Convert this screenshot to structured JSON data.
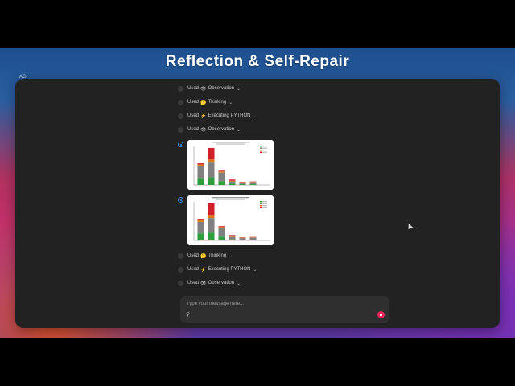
{
  "overlay": {
    "title": "Reflection & Self-Repair"
  },
  "sidebar_peek": {
    "label": "AGI"
  },
  "messages": [
    {
      "prefix": "Used",
      "icon": "👁",
      "icon_name": "eye-icon",
      "label": "Observation"
    },
    {
      "prefix": "Used",
      "icon": "🤔",
      "icon_name": "thinking-icon",
      "label": "Thinking"
    },
    {
      "prefix": "Used",
      "icon": "⚡",
      "icon_name": "lightning-icon",
      "label": "Executing PYTHON"
    },
    {
      "prefix": "Used",
      "icon": "👁",
      "icon_name": "eye-icon",
      "label": "Observation"
    },
    {
      "prefix": "Used",
      "icon": "🤔",
      "icon_name": "thinking-icon",
      "label": "Thinking"
    },
    {
      "prefix": "Used",
      "icon": "⚡",
      "icon_name": "lightning-icon",
      "label": "Executing PYTHON"
    },
    {
      "prefix": "Used",
      "icon": "👁",
      "icon_name": "eye-icon",
      "label": "Observation"
    }
  ],
  "chart_data": [
    {
      "type": "bar",
      "stacked": true,
      "categories": [
        "1",
        "2",
        "3",
        "4",
        "5",
        "6"
      ],
      "ylim": [
        0,
        100
      ],
      "series": [
        {
          "values": [
            18,
            20,
            10,
            3,
            2,
            2
          ],
          "color": "#2e9e3e"
        },
        {
          "values": [
            30,
            38,
            22,
            6,
            4,
            5
          ],
          "color": "#808080"
        },
        {
          "values": [
            5,
            8,
            3,
            2,
            1,
            1
          ],
          "color": "#e07b1a"
        },
        {
          "values": [
            3,
            30,
            2,
            3,
            1,
            1
          ],
          "color": "#d0202a"
        }
      ]
    },
    {
      "type": "bar",
      "stacked": true,
      "categories": [
        "1",
        "2",
        "3",
        "4",
        "5",
        "6"
      ],
      "ylim": [
        0,
        100
      ],
      "series": [
        {
          "values": [
            18,
            20,
            10,
            3,
            2,
            2
          ],
          "color": "#2e9e3e"
        },
        {
          "values": [
            30,
            38,
            22,
            6,
            4,
            5
          ],
          "color": "#808080"
        },
        {
          "values": [
            5,
            8,
            3,
            2,
            1,
            1
          ],
          "color": "#e07b1a"
        },
        {
          "values": [
            3,
            30,
            2,
            3,
            1,
            1
          ],
          "color": "#d0202a"
        }
      ]
    }
  ],
  "composer": {
    "placeholder": "Type your message here..."
  },
  "colors": {
    "window_bg": "#222222",
    "accent": "#3a8ee6",
    "send": "#e8245a"
  }
}
